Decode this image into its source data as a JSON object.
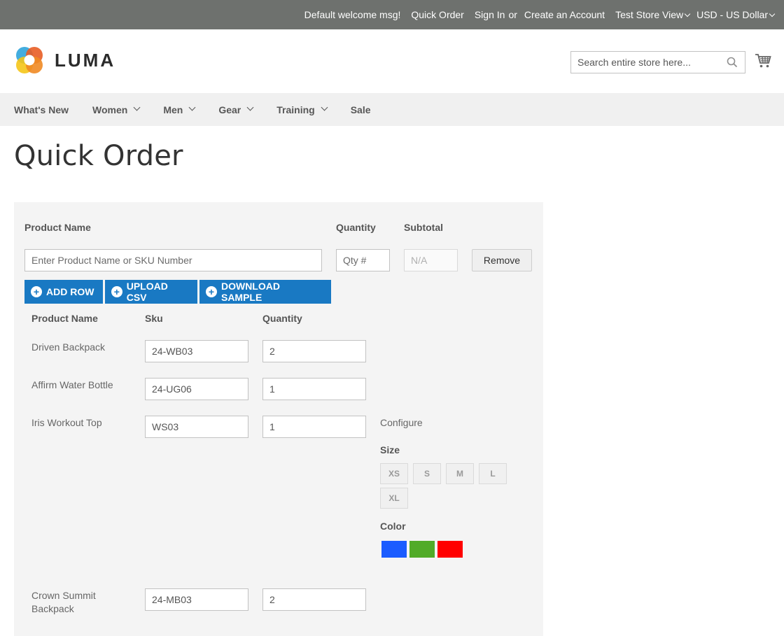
{
  "topbar": {
    "welcome": "Default welcome msg!",
    "quick_order": "Quick Order",
    "sign_in": "Sign In",
    "or": "or",
    "create_account": "Create an Account",
    "store_view": "Test Store View",
    "currency": "USD - US Dollar"
  },
  "header": {
    "logo_text": "LUMA",
    "search_placeholder": "Search entire store here..."
  },
  "nav": [
    "What's New",
    "Women",
    "Men",
    "Gear",
    "Training",
    "Sale"
  ],
  "page_title": "Quick Order",
  "form": {
    "col_product_name": "Product Name",
    "col_quantity": "Quantity",
    "col_subtotal": "Subtotal",
    "product_placeholder": "Enter Product Name or SKU Number",
    "qty_placeholder": "Qty #",
    "subtotal_value": "N/A",
    "remove": "Remove",
    "add_row": "ADD ROW",
    "upload_csv": "UPLOAD CSV",
    "download_sample": "DOWNLOAD SAMPLE"
  },
  "list": {
    "col_product_name": "Product Name",
    "col_sku": "Sku",
    "col_quantity": "Quantity",
    "rows": [
      {
        "name": "Driven Backpack",
        "sku": "24-WB03",
        "qty": "2"
      },
      {
        "name": "Affirm Water Bottle",
        "sku": "24-UG06",
        "qty": "1"
      },
      {
        "name": "Iris Workout Top",
        "sku": "WS03",
        "qty": "1"
      },
      {
        "name": "Crown Summit Backpack",
        "sku": "24-MB03",
        "qty": "2"
      }
    ],
    "configure": "Configure",
    "size_label": "Size",
    "sizes": [
      "XS",
      "S",
      "M",
      "L",
      "XL"
    ],
    "color_label": "Color",
    "colors": [
      "#1b5cff",
      "#51ab28",
      "#ff0000"
    ]
  }
}
